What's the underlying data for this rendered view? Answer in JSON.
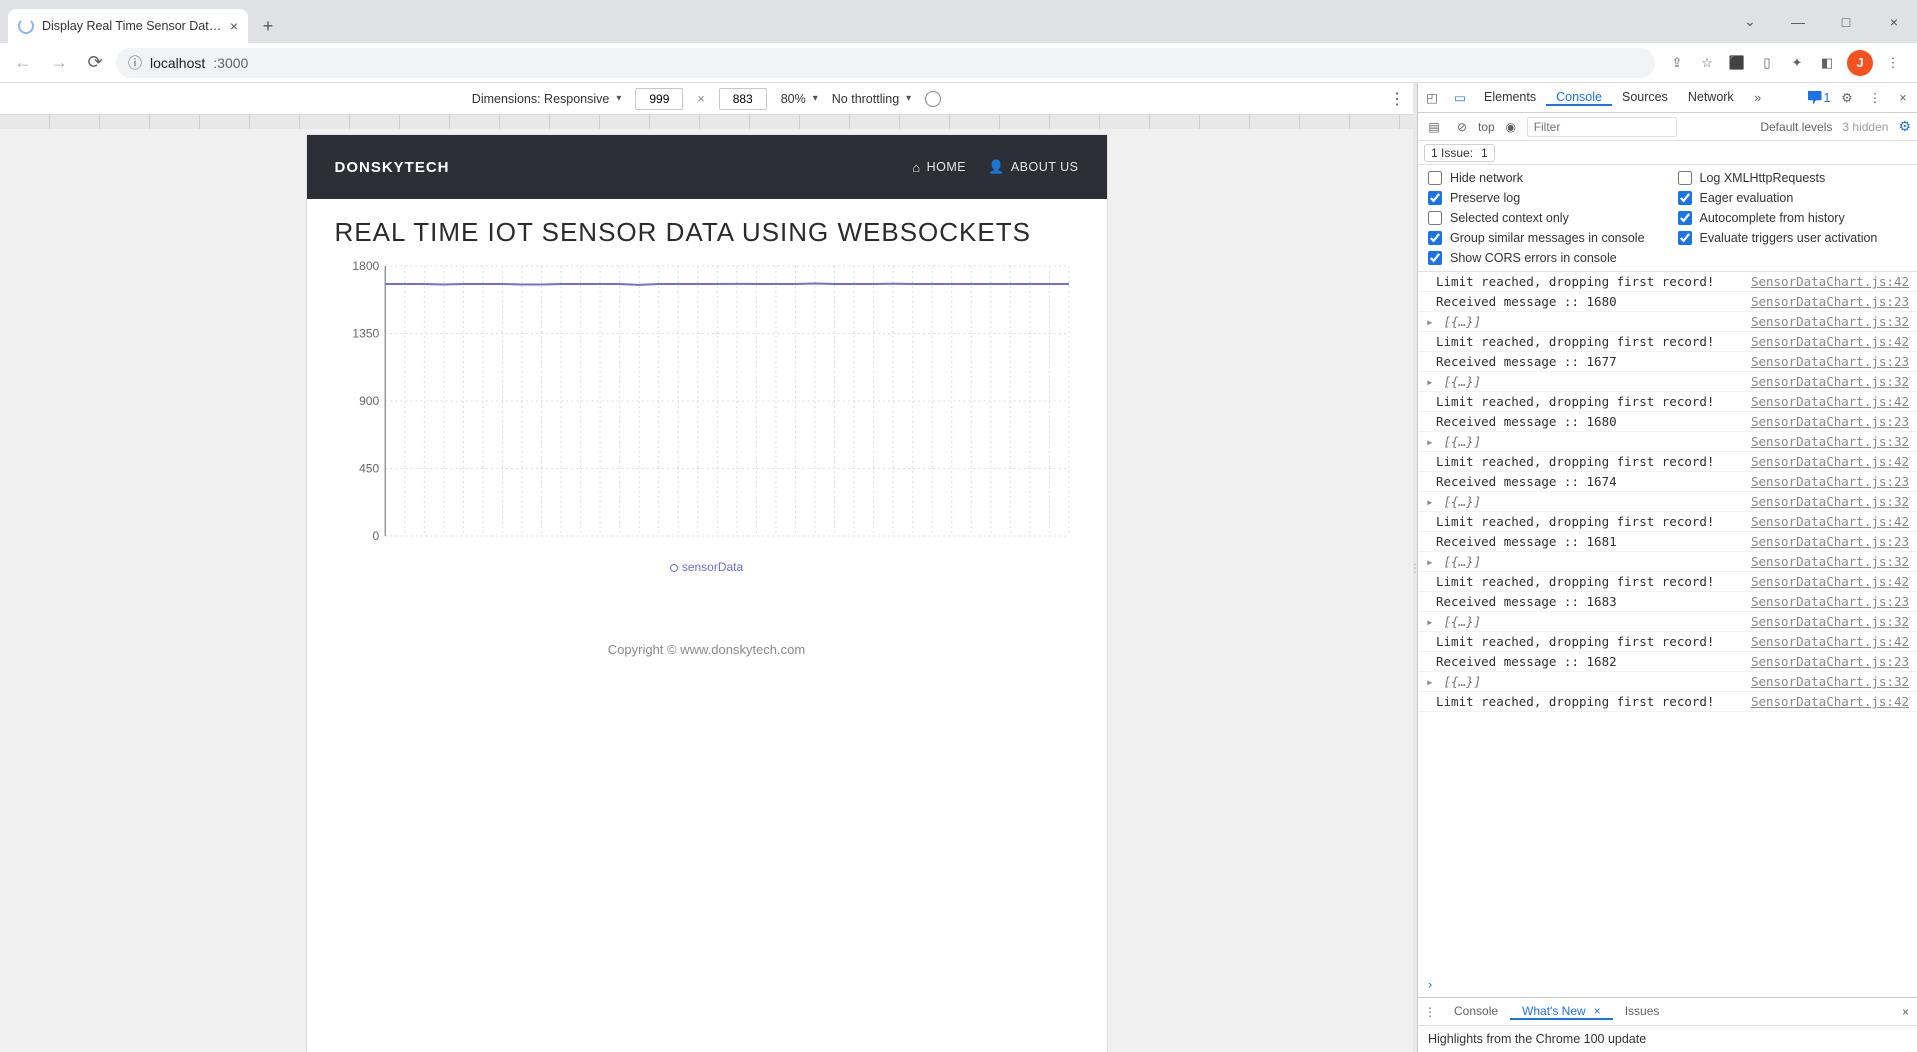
{
  "browser": {
    "tab_title": "Display Real Time Sensor Data th",
    "url_prefix_icon": "ⓘ",
    "url_host": "localhost",
    "url_port": ":3000",
    "avatar_letter": "J"
  },
  "device_bar": {
    "dimensions_label": "Dimensions: Responsive",
    "width": "999",
    "height": "883",
    "zoom": "80%",
    "throttling": "No throttling"
  },
  "page": {
    "brand": "DONSKYTECH",
    "nav_home": "HOME",
    "nav_about": "ABOUT US",
    "title": "REAL TIME IOT SENSOR DATA USING WEBSOCKETS",
    "legend": "sensorData",
    "footer": "Copyright © www.donskytech.com"
  },
  "chart_data": {
    "type": "line",
    "title": "",
    "xlabel": "",
    "ylabel": "",
    "ylim": [
      0,
      1800
    ],
    "yticks": [
      0,
      450,
      900,
      1350,
      1800
    ],
    "series": [
      {
        "name": "sensorData",
        "values": [
          1680,
          1680,
          1680,
          1677,
          1680,
          1680,
          1680,
          1677,
          1677,
          1680,
          1680,
          1680,
          1680,
          1674,
          1680,
          1680,
          1680,
          1680,
          1681,
          1680,
          1680,
          1680,
          1683,
          1680,
          1680,
          1680,
          1682,
          1680,
          1680,
          1680,
          1680,
          1680,
          1680,
          1680,
          1680,
          1680
        ]
      }
    ]
  },
  "devtools": {
    "tabs": [
      "Elements",
      "Console",
      "Sources",
      "Network"
    ],
    "active_tab": "Console",
    "more_tabs_icon": "»",
    "issues_badge": "1",
    "filter": {
      "context": "top",
      "placeholder": "Filter",
      "levels": "Default levels",
      "hidden": "3 hidden"
    },
    "issue_bar": {
      "label": "1 Issue:",
      "count": "1"
    },
    "settings": [
      {
        "label": "Hide network",
        "checked": false
      },
      {
        "label": "Log XMLHttpRequests",
        "checked": false
      },
      {
        "label": "Preserve log",
        "checked": true
      },
      {
        "label": "Eager evaluation",
        "checked": true
      },
      {
        "label": "Selected context only",
        "checked": false
      },
      {
        "label": "Autocomplete from history",
        "checked": true
      },
      {
        "label": "Group similar messages in console",
        "checked": true
      },
      {
        "label": "Evaluate triggers user activation",
        "checked": true
      },
      {
        "label": "Show CORS errors in console",
        "checked": true
      }
    ],
    "logs": [
      {
        "type": "log",
        "text": "Limit reached, dropping first record!",
        "src": "SensorDataChart.js:42"
      },
      {
        "type": "log",
        "text": "Received message :: 1680",
        "src": "SensorDataChart.js:23"
      },
      {
        "type": "obj",
        "text": "[{…}]",
        "src": "SensorDataChart.js:32"
      },
      {
        "type": "log",
        "text": "Limit reached, dropping first record!",
        "src": "SensorDataChart.js:42"
      },
      {
        "type": "log",
        "text": "Received message :: 1677",
        "src": "SensorDataChart.js:23"
      },
      {
        "type": "obj",
        "text": "[{…}]",
        "src": "SensorDataChart.js:32"
      },
      {
        "type": "log",
        "text": "Limit reached, dropping first record!",
        "src": "SensorDataChart.js:42"
      },
      {
        "type": "log",
        "text": "Received message :: 1680",
        "src": "SensorDataChart.js:23"
      },
      {
        "type": "obj",
        "text": "[{…}]",
        "src": "SensorDataChart.js:32"
      },
      {
        "type": "log",
        "text": "Limit reached, dropping first record!",
        "src": "SensorDataChart.js:42"
      },
      {
        "type": "log",
        "text": "Received message :: 1674",
        "src": "SensorDataChart.js:23"
      },
      {
        "type": "obj",
        "text": "[{…}]",
        "src": "SensorDataChart.js:32"
      },
      {
        "type": "log",
        "text": "Limit reached, dropping first record!",
        "src": "SensorDataChart.js:42"
      },
      {
        "type": "log",
        "text": "Received message :: 1681",
        "src": "SensorDataChart.js:23"
      },
      {
        "type": "obj",
        "text": "[{…}]",
        "src": "SensorDataChart.js:32"
      },
      {
        "type": "log",
        "text": "Limit reached, dropping first record!",
        "src": "SensorDataChart.js:42"
      },
      {
        "type": "log",
        "text": "Received message :: 1683",
        "src": "SensorDataChart.js:23"
      },
      {
        "type": "obj",
        "text": "[{…}]",
        "src": "SensorDataChart.js:32"
      },
      {
        "type": "log",
        "text": "Limit reached, dropping first record!",
        "src": "SensorDataChart.js:42"
      },
      {
        "type": "log",
        "text": "Received message :: 1682",
        "src": "SensorDataChart.js:23"
      },
      {
        "type": "obj",
        "text": "[{…}]",
        "src": "SensorDataChart.js:32"
      },
      {
        "type": "log",
        "text": "Limit reached, dropping first record!",
        "src": "SensorDataChart.js:42"
      }
    ],
    "drawer": {
      "tabs": [
        "Console",
        "What's New",
        "Issues"
      ],
      "active": "What's New",
      "body": "Highlights from the Chrome 100 update"
    }
  }
}
